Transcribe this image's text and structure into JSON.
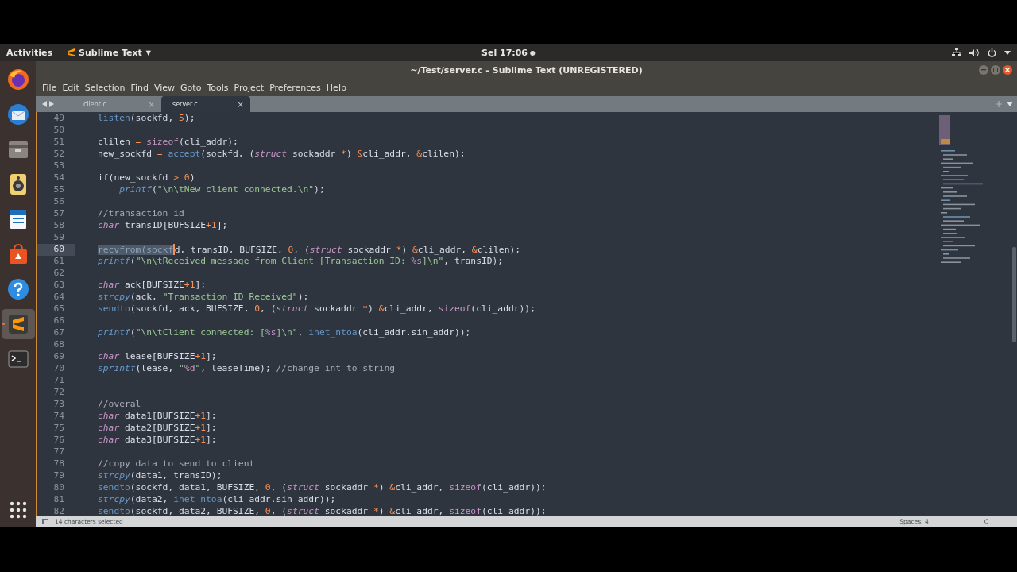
{
  "top_bar": {
    "activities": "Activities",
    "app_menu": "Sublime Text",
    "app_menu_caret": "▼",
    "clock": "Sel 17:06",
    "clock_dot": "●"
  },
  "dock": {
    "items": [
      {
        "kind": "browser",
        "selected": false
      },
      {
        "kind": "mail",
        "selected": false
      },
      {
        "kind": "files",
        "selected": false
      },
      {
        "kind": "music",
        "selected": false
      },
      {
        "kind": "document",
        "selected": false
      },
      {
        "kind": "store",
        "selected": false
      },
      {
        "kind": "help",
        "selected": false
      },
      {
        "kind": "editor",
        "selected": true
      },
      {
        "kind": "terminal",
        "selected": false
      }
    ]
  },
  "window": {
    "title": "~/Test/server.c - Sublime Text (UNREGISTERED)"
  },
  "menu": [
    "File",
    "Edit",
    "Selection",
    "Find",
    "View",
    "Goto",
    "Tools",
    "Project",
    "Preferences",
    "Help"
  ],
  "tabs": [
    {
      "label": "client.c",
      "selected": false,
      "close": "×"
    },
    {
      "label": "server.c",
      "selected": true,
      "close": "×"
    }
  ],
  "editor": {
    "lines": [
      {
        "n": "49",
        "current": false,
        "tokens": [
          {
            "kind": "function",
            "text": "listen"
          },
          {
            "kind": "plain",
            "text": "(sockfd, "
          },
          {
            "kind": "operator",
            "text": "5"
          },
          {
            "kind": "plain",
            "text": ");"
          }
        ]
      },
      {
        "n": "50",
        "current": false
      },
      {
        "n": "51",
        "current": false,
        "tokens": [
          {
            "kind": "plain",
            "text": "clilen "
          },
          {
            "kind": "operator",
            "text": "= "
          },
          {
            "kind": "keyword",
            "text": "sizeof"
          },
          {
            "kind": "plain",
            "text": "(cli_addr);"
          }
        ]
      },
      {
        "n": "52",
        "current": false,
        "tokens": [
          {
            "kind": "plain",
            "text": "new_sockfd "
          },
          {
            "kind": "operator",
            "text": "= "
          },
          {
            "kind": "function",
            "text": "accept"
          },
          {
            "kind": "plain",
            "text": "(sockfd, ("
          },
          {
            "kind": "type",
            "text": "struct"
          },
          {
            "kind": "plain",
            "text": " sockaddr "
          },
          {
            "kind": "operator",
            "text": "*"
          },
          {
            "kind": "plain",
            "text": ") "
          },
          {
            "kind": "operator",
            "text": "&"
          },
          {
            "kind": "plain",
            "text": "cli_addr, "
          },
          {
            "kind": "operator",
            "text": "&"
          },
          {
            "kind": "plain",
            "text": "clilen);"
          }
        ]
      },
      {
        "n": "53",
        "current": false
      },
      {
        "n": "54",
        "current": false,
        "tokens": [
          {
            "kind": "plain",
            "text": "if(new_sockfd "
          },
          {
            "kind": "operator",
            "text": "> 0"
          },
          {
            "kind": "plain",
            "text": ")"
          }
        ]
      },
      {
        "n": "55",
        "current": false,
        "tokens": [
          {
            "kind": "call",
            "text": "    printf"
          },
          {
            "kind": "plain",
            "text": "("
          },
          {
            "kind": "string",
            "text": "\"\\n\\tNew client connected.\\n\""
          },
          {
            "kind": "plain",
            "text": ");"
          }
        ]
      },
      {
        "n": "56",
        "current": false
      },
      {
        "n": "57",
        "current": false,
        "tokens": [
          {
            "kind": "comment",
            "text": "//transaction id"
          }
        ]
      },
      {
        "n": "58",
        "current": false,
        "tokens": [
          {
            "kind": "type",
            "text": "char"
          },
          {
            "kind": "plain",
            "text": " transID[BUFSIZE"
          },
          {
            "kind": "operator",
            "text": "+1"
          },
          {
            "kind": "plain",
            "text": "];"
          }
        ]
      },
      {
        "n": "59",
        "current": false
      },
      {
        "n": "60",
        "current": true,
        "tokens": [
          {
            "kind": "selection",
            "text": "recvfrom(sockf"
          },
          {
            "kind": "plain",
            "text": "d, transID, BUFSIZE, "
          },
          {
            "kind": "operator",
            "text": "0"
          },
          {
            "kind": "plain",
            "text": ", ("
          },
          {
            "kind": "type",
            "text": "struct"
          },
          {
            "kind": "plain",
            "text": " sockaddr "
          },
          {
            "kind": "operator",
            "text": "*"
          },
          {
            "kind": "plain",
            "text": ") "
          },
          {
            "kind": "operator",
            "text": "&"
          },
          {
            "kind": "plain",
            "text": "cli_addr, "
          },
          {
            "kind": "operator",
            "text": "&"
          },
          {
            "kind": "plain",
            "text": "clilen);"
          }
        ]
      },
      {
        "n": "61",
        "current": false,
        "tokens": [
          {
            "kind": "call",
            "text": "printf"
          },
          {
            "kind": "plain",
            "text": "("
          },
          {
            "kind": "string",
            "text": "\"\\n\\tReceived message from Client [Transaction ID: "
          },
          {
            "kind": "format",
            "text": "%s"
          },
          {
            "kind": "string",
            "text": "]\\n\""
          },
          {
            "kind": "plain",
            "text": ", transID);"
          }
        ]
      },
      {
        "n": "62",
        "current": false
      },
      {
        "n": "63",
        "current": false,
        "tokens": [
          {
            "kind": "type",
            "text": "char"
          },
          {
            "kind": "plain",
            "text": " ack[BUFSIZE"
          },
          {
            "kind": "operator",
            "text": "+1"
          },
          {
            "kind": "plain",
            "text": "];"
          }
        ]
      },
      {
        "n": "64",
        "current": false,
        "tokens": [
          {
            "kind": "call",
            "text": "strcpy"
          },
          {
            "kind": "plain",
            "text": "(ack, "
          },
          {
            "kind": "string",
            "text": "\"Transaction ID Received\""
          },
          {
            "kind": "plain",
            "text": ");"
          }
        ]
      },
      {
        "n": "65",
        "current": false,
        "tokens": [
          {
            "kind": "function",
            "text": "sendto"
          },
          {
            "kind": "plain",
            "text": "(sockfd, ack, BUFSIZE, "
          },
          {
            "kind": "operator",
            "text": "0"
          },
          {
            "kind": "plain",
            "text": ", ("
          },
          {
            "kind": "type",
            "text": "struct"
          },
          {
            "kind": "plain",
            "text": " sockaddr "
          },
          {
            "kind": "operator",
            "text": "*"
          },
          {
            "kind": "plain",
            "text": ") "
          },
          {
            "kind": "operator",
            "text": "&"
          },
          {
            "kind": "plain",
            "text": "cli_addr, "
          },
          {
            "kind": "keyword",
            "text": "sizeof"
          },
          {
            "kind": "plain",
            "text": "(cli_addr));"
          }
        ]
      },
      {
        "n": "66",
        "current": false
      },
      {
        "n": "67",
        "current": false,
        "tokens": [
          {
            "kind": "call",
            "text": "printf"
          },
          {
            "kind": "plain",
            "text": "("
          },
          {
            "kind": "string",
            "text": "\"\\n\\tClient connected: ["
          },
          {
            "kind": "format",
            "text": "%s"
          },
          {
            "kind": "string",
            "text": "]\\n\""
          },
          {
            "kind": "plain",
            "text": ", "
          },
          {
            "kind": "function",
            "text": "inet_ntoa"
          },
          {
            "kind": "plain",
            "text": "(cli_addr.sin_addr));"
          }
        ]
      },
      {
        "n": "68",
        "current": false
      },
      {
        "n": "69",
        "current": false,
        "tokens": [
          {
            "kind": "type",
            "text": "char"
          },
          {
            "kind": "plain",
            "text": " lease[BUFSIZE"
          },
          {
            "kind": "operator",
            "text": "+1"
          },
          {
            "kind": "plain",
            "text": "];"
          }
        ]
      },
      {
        "n": "70",
        "current": false,
        "tokens": [
          {
            "kind": "call",
            "text": "sprintf"
          },
          {
            "kind": "plain",
            "text": "(lease, "
          },
          {
            "kind": "string",
            "text": "\""
          },
          {
            "kind": "format",
            "text": "%d"
          },
          {
            "kind": "string",
            "text": "\""
          },
          {
            "kind": "plain",
            "text": ", leaseTime); "
          },
          {
            "kind": "comment",
            "text": "//change int to string"
          }
        ]
      },
      {
        "n": "71",
        "current": false
      },
      {
        "n": "72",
        "current": false
      },
      {
        "n": "73",
        "current": false,
        "tokens": [
          {
            "kind": "comment",
            "text": "//overal"
          }
        ]
      },
      {
        "n": "74",
        "current": false,
        "tokens": [
          {
            "kind": "type",
            "text": "char"
          },
          {
            "kind": "plain",
            "text": " data1[BUFSIZE"
          },
          {
            "kind": "operator",
            "text": "+1"
          },
          {
            "kind": "plain",
            "text": "];"
          }
        ]
      },
      {
        "n": "75",
        "current": false,
        "tokens": [
          {
            "kind": "type",
            "text": "char"
          },
          {
            "kind": "plain",
            "text": " data2[BUFSIZE"
          },
          {
            "kind": "operator",
            "text": "+1"
          },
          {
            "kind": "plain",
            "text": "];"
          }
        ]
      },
      {
        "n": "76",
        "current": false,
        "tokens": [
          {
            "kind": "type",
            "text": "char"
          },
          {
            "kind": "plain",
            "text": " data3[BUFSIZE"
          },
          {
            "kind": "operator",
            "text": "+1"
          },
          {
            "kind": "plain",
            "text": "];"
          }
        ]
      },
      {
        "n": "77",
        "current": false
      },
      {
        "n": "78",
        "current": false,
        "tokens": [
          {
            "kind": "comment",
            "text": "//copy data to send to client"
          }
        ]
      },
      {
        "n": "79",
        "current": false,
        "tokens": [
          {
            "kind": "call",
            "text": "strcpy"
          },
          {
            "kind": "plain",
            "text": "(data1, transID);"
          }
        ]
      },
      {
        "n": "80",
        "current": false,
        "tokens": [
          {
            "kind": "function",
            "text": "sendto"
          },
          {
            "kind": "plain",
            "text": "(sockfd, data1, BUFSIZE, "
          },
          {
            "kind": "operator",
            "text": "0"
          },
          {
            "kind": "plain",
            "text": ", ("
          },
          {
            "kind": "type",
            "text": "struct"
          },
          {
            "kind": "plain",
            "text": " sockaddr "
          },
          {
            "kind": "operator",
            "text": "*"
          },
          {
            "kind": "plain",
            "text": ") "
          },
          {
            "kind": "operator",
            "text": "&"
          },
          {
            "kind": "plain",
            "text": "cli_addr, "
          },
          {
            "kind": "keyword",
            "text": "sizeof"
          },
          {
            "kind": "plain",
            "text": "(cli_addr));"
          }
        ]
      },
      {
        "n": "81",
        "current": false,
        "tokens": [
          {
            "kind": "call",
            "text": "strcpy"
          },
          {
            "kind": "plain",
            "text": "(data2, "
          },
          {
            "kind": "function",
            "text": "inet_ntoa"
          },
          {
            "kind": "plain",
            "text": "(cli_addr.sin_addr));"
          }
        ]
      },
      {
        "n": "82",
        "current": false,
        "tokens": [
          {
            "kind": "function",
            "text": "sendto"
          },
          {
            "kind": "plain",
            "text": "(sockfd, data2, BUFSIZE, "
          },
          {
            "kind": "operator",
            "text": "0"
          },
          {
            "kind": "plain",
            "text": ", ("
          },
          {
            "kind": "type",
            "text": "struct"
          },
          {
            "kind": "plain",
            "text": " sockaddr "
          },
          {
            "kind": "operator",
            "text": "*"
          },
          {
            "kind": "plain",
            "text": ") "
          },
          {
            "kind": "operator",
            "text": "&"
          },
          {
            "kind": "plain",
            "text": "cli_addr, "
          },
          {
            "kind": "keyword",
            "text": "sizeof"
          },
          {
            "kind": "plain",
            "text": "(cli_addr));"
          }
        ]
      }
    ]
  },
  "status_bar": {
    "selection": "14 characters selected",
    "indentation": "Spaces: 4",
    "syntax": "C"
  }
}
